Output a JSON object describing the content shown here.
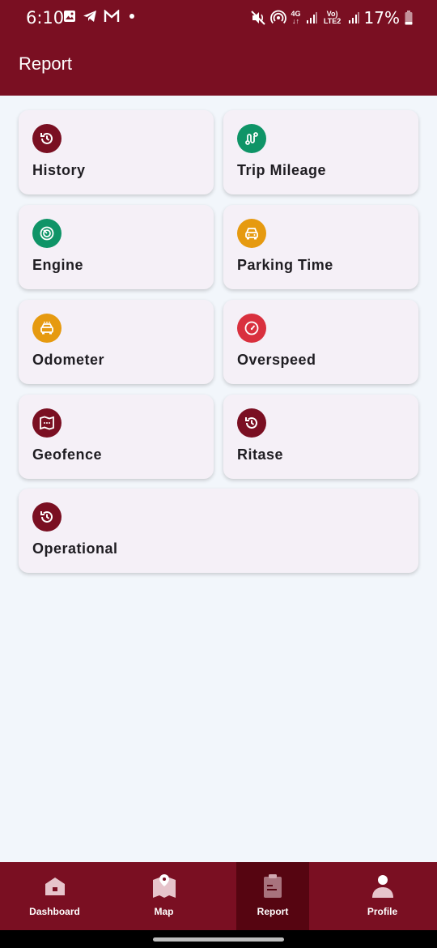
{
  "status_bar": {
    "time": "6:10",
    "battery": "17%",
    "network_4g": "4G",
    "network_lte": "Vo) LTE2"
  },
  "app_bar": {
    "title": "Report"
  },
  "colors": {
    "primary": "#7a0f22",
    "active_nav": "#560511",
    "green": "#0f9467",
    "orange": "#e69a10",
    "red": "#d9303e",
    "maroon": "#7a0f22"
  },
  "reports": [
    {
      "label": "History",
      "icon": "history-icon"
    },
    {
      "label": "Trip Mileage",
      "icon": "route-icon"
    },
    {
      "label": "Engine",
      "icon": "engine-icon"
    },
    {
      "label": "Parking Time",
      "icon": "car-icon"
    },
    {
      "label": "Odometer",
      "icon": "taxi-icon"
    },
    {
      "label": "Overspeed",
      "icon": "speedometer-icon"
    },
    {
      "label": "Geofence",
      "icon": "map-area-icon"
    },
    {
      "label": "Ritase",
      "icon": "history-icon"
    },
    {
      "label": "Operational",
      "icon": "history-icon"
    }
  ],
  "bottom_nav": {
    "items": [
      {
        "label": "Dashboard",
        "icon": "home-icon"
      },
      {
        "label": "Map",
        "icon": "map-icon"
      },
      {
        "label": "Report",
        "icon": "clipboard-icon",
        "active": true
      },
      {
        "label": "Profile",
        "icon": "person-icon"
      }
    ]
  }
}
